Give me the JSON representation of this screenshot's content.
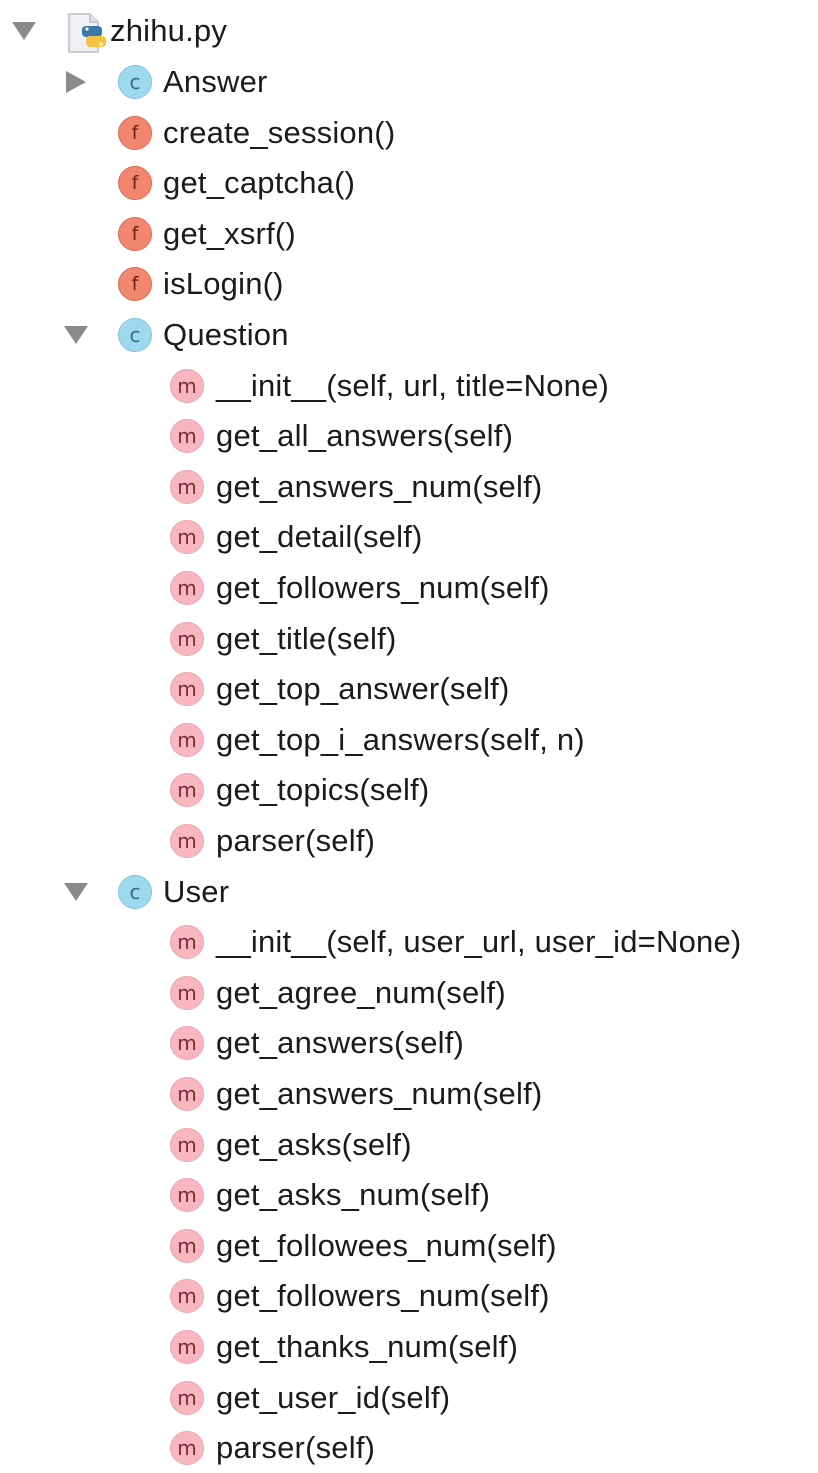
{
  "file": {
    "name": "zhihu.py",
    "icon": "python-file-icon",
    "expanded": true
  },
  "items": [
    {
      "kind": "C",
      "label": "Answer",
      "expanded": false
    },
    {
      "kind": "f",
      "label": "create_session()"
    },
    {
      "kind": "f",
      "label": "get_captcha()"
    },
    {
      "kind": "f",
      "label": "get_xsrf()"
    },
    {
      "kind": "f",
      "label": "isLogin()"
    },
    {
      "kind": "C",
      "label": "Question",
      "expanded": true
    },
    {
      "kind": "m",
      "label": "__init__(self, url, title=None)"
    },
    {
      "kind": "m",
      "label": "get_all_answers(self)"
    },
    {
      "kind": "m",
      "label": "get_answers_num(self)"
    },
    {
      "kind": "m",
      "label": "get_detail(self)"
    },
    {
      "kind": "m",
      "label": "get_followers_num(self)"
    },
    {
      "kind": "m",
      "label": "get_title(self)"
    },
    {
      "kind": "m",
      "label": "get_top_answer(self)"
    },
    {
      "kind": "m",
      "label": "get_top_i_answers(self, n)"
    },
    {
      "kind": "m",
      "label": "get_topics(self)"
    },
    {
      "kind": "m",
      "label": "parser(self)"
    },
    {
      "kind": "C",
      "label": "User",
      "expanded": true
    },
    {
      "kind": "m",
      "label": "__init__(self, user_url, user_id=None)"
    },
    {
      "kind": "m",
      "label": "get_agree_num(self)"
    },
    {
      "kind": "m",
      "label": "get_answers(self)"
    },
    {
      "kind": "m",
      "label": "get_answers_num(self)"
    },
    {
      "kind": "m",
      "label": "get_asks(self)"
    },
    {
      "kind": "m",
      "label": "get_asks_num(self)"
    },
    {
      "kind": "m",
      "label": "get_followees_num(self)"
    },
    {
      "kind": "m",
      "label": "get_followers_num(self)"
    },
    {
      "kind": "m",
      "label": "get_thanks_num(self)"
    },
    {
      "kind": "m",
      "label": "get_user_id(self)"
    },
    {
      "kind": "m",
      "label": "parser(self)"
    }
  ],
  "badge_letters": {
    "C": "c",
    "f": "f",
    "m": "m"
  },
  "colors": {
    "class_badge": "#9fd9ef",
    "function_badge": "#f2866e",
    "method_badge": "#f7b7c0",
    "arrow": "#8a8a8a"
  }
}
